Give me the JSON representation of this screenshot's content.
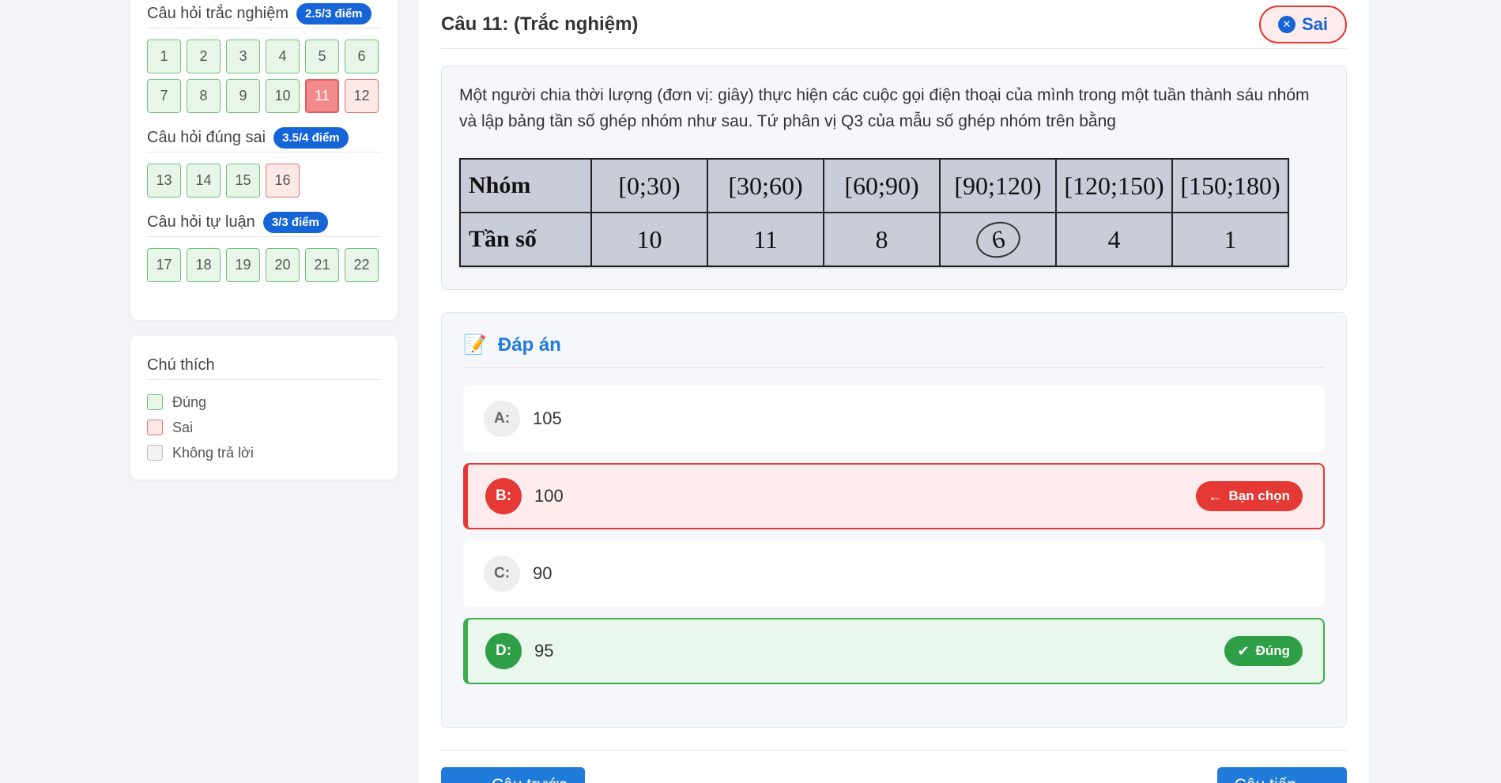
{
  "sidebar": {
    "sections": [
      {
        "title": "Câu hỏi trắc nghiệm",
        "score": "2.5/3 điểm"
      },
      {
        "title": "Câu hỏi đúng sai",
        "score": "3.5/4 điểm"
      },
      {
        "title": "Câu hỏi tự luận",
        "score": "3/3 điểm"
      }
    ],
    "mc_questions": [
      "1",
      "2",
      "3",
      "4",
      "5",
      "6",
      "7",
      "8",
      "9",
      "10",
      "11",
      "12"
    ],
    "tf_questions": [
      "13",
      "14",
      "15",
      "16"
    ],
    "essay_questions": [
      "17",
      "18",
      "19",
      "20",
      "21",
      "22"
    ]
  },
  "legend": {
    "title": "Chú thích",
    "items": [
      "Đúng",
      "Sai",
      "Không trả lời"
    ]
  },
  "question": {
    "title": "Câu 11: (Trắc nghiệm)",
    "status": "Sai",
    "text": "Một người chia thời lượng (đơn vị: giây) thực hiện các cuộc gọi điện thoại của mình trong một tuần thành sáu nhóm và lập bảng tần số ghép nhóm như sau. Tứ phân vị Q3 của mẫu số ghép nhóm trên bằng",
    "table": {
      "row1_label": "Nhóm",
      "groups": [
        "[0;30)",
        "[30;60)",
        "[60;90)",
        "[90;120)",
        "[120;150)",
        "[150;180)"
      ],
      "row2_label": "Tần số",
      "freqs": [
        "10",
        "11",
        "8",
        "6",
        "4",
        "1"
      ]
    }
  },
  "answers": {
    "title": "Đáp án",
    "options": [
      {
        "letter": "A:",
        "value": "105"
      },
      {
        "letter": "B:",
        "value": "100"
      },
      {
        "letter": "C:",
        "value": "90"
      },
      {
        "letter": "D:",
        "value": "95"
      }
    ],
    "chosen_tag": "Bạn chọn",
    "correct_tag": "Đúng"
  },
  "nav": {
    "prev": "Câu trước",
    "next": "Câu tiếp"
  }
}
